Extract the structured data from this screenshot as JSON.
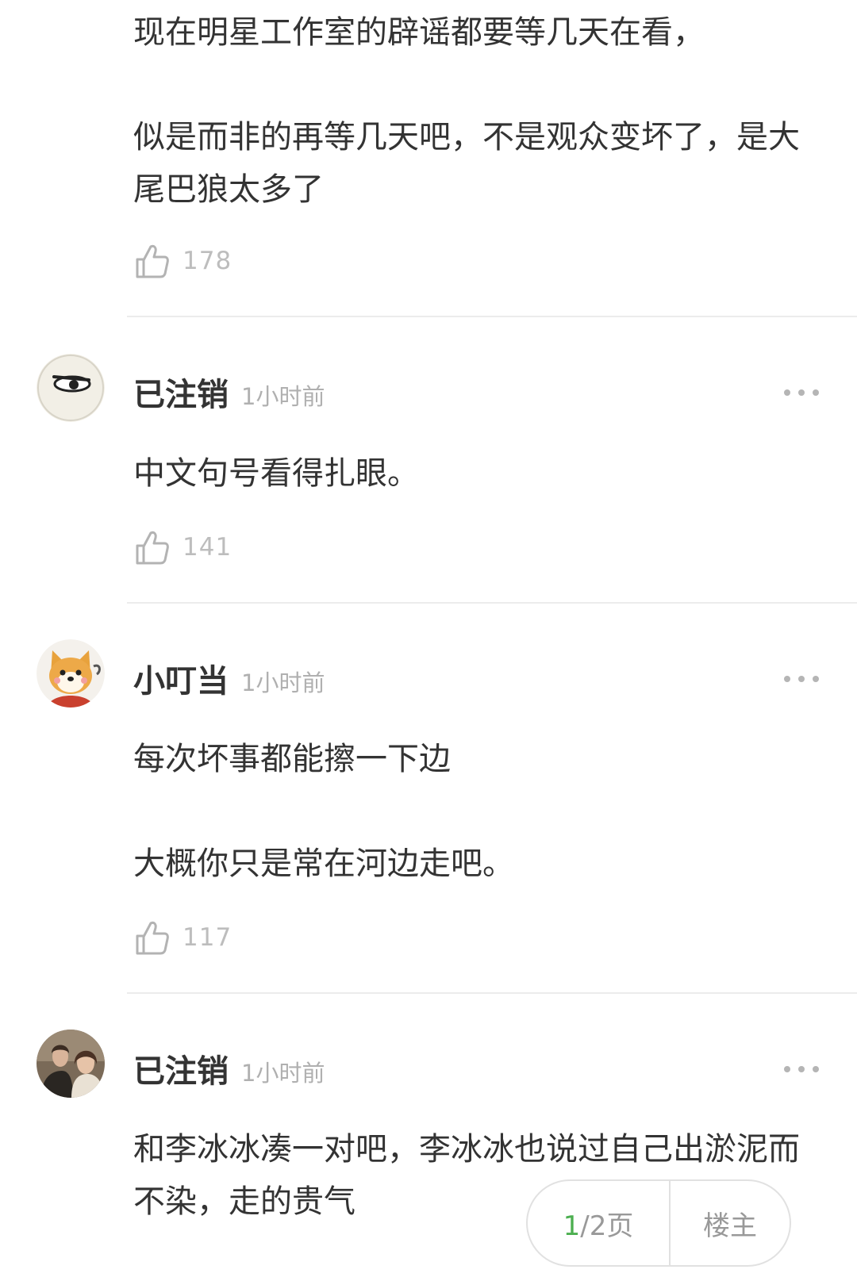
{
  "comments": [
    {
      "paragraphs": [
        "现在明星工作室的辟谣都要等几天在看，",
        "似是而非的再等几天吧，不是观众变坏了，是大尾巴狼太多了"
      ],
      "likes": "178"
    },
    {
      "username": "已注销",
      "time": "1小时前",
      "avatar": "eye-cartoon",
      "paragraphs": [
        "中文句号看得扎眼。"
      ],
      "likes": "141"
    },
    {
      "username": "小叮当",
      "time": "1小时前",
      "avatar": "shiba-dog",
      "paragraphs": [
        "每次坏事都能擦一下边",
        "大概你只是常在河边走吧。"
      ],
      "likes": "117"
    },
    {
      "username": "已注销",
      "time": "1小时前",
      "avatar": "couple-photo",
      "paragraphs": [
        "和李冰冰凑一对吧，李冰冰也说过自己出淤泥而不染，走的贵气"
      ]
    }
  ],
  "pager": {
    "current": "1",
    "total_suffix": "/2页",
    "op_label": "楼主"
  },
  "colors": {
    "accent": "#4caf50",
    "muted": "#b0b0b0",
    "text": "#333333"
  },
  "icons": [
    "thumbs-up-icon",
    "more-icon"
  ]
}
